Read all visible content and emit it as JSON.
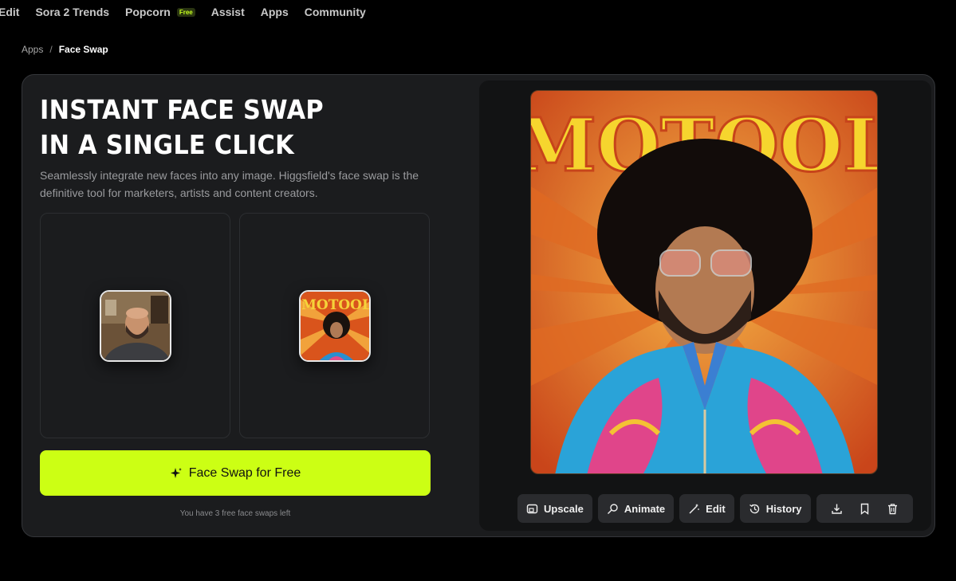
{
  "nav": {
    "items": [
      {
        "label": "Edit"
      },
      {
        "label": "Sora 2 Trends"
      },
      {
        "label": "Popcorn",
        "badge": "Free"
      },
      {
        "label": "Assist"
      },
      {
        "label": "Apps"
      },
      {
        "label": "Community"
      }
    ]
  },
  "breadcrumb": {
    "parent": "Apps",
    "separator": "/",
    "current": "Face Swap"
  },
  "hero": {
    "title_line1": "INSTANT FACE SWAP",
    "title_line2": "IN A SINGLE CLICK",
    "description": "Seamlessly integrate new faces into any image. Higgsfield's face swap is the definitive tool for marketers, artists and content creators."
  },
  "uploads": {
    "face_icon": "face-photo-thumbnail",
    "target_icon": "target-poster-thumbnail",
    "poster_text": "MOTOOL"
  },
  "cta": {
    "label": "Face Swap for Free",
    "icon": "sparkle-icon"
  },
  "credits": {
    "text": "You have 3 free face swaps left"
  },
  "toolbar": {
    "upscale": "Upscale",
    "animate": "Animate",
    "edit": "Edit",
    "history": "History"
  },
  "colors": {
    "accent": "#ccff14",
    "background": "#000000",
    "card": "#1b1c1e"
  }
}
